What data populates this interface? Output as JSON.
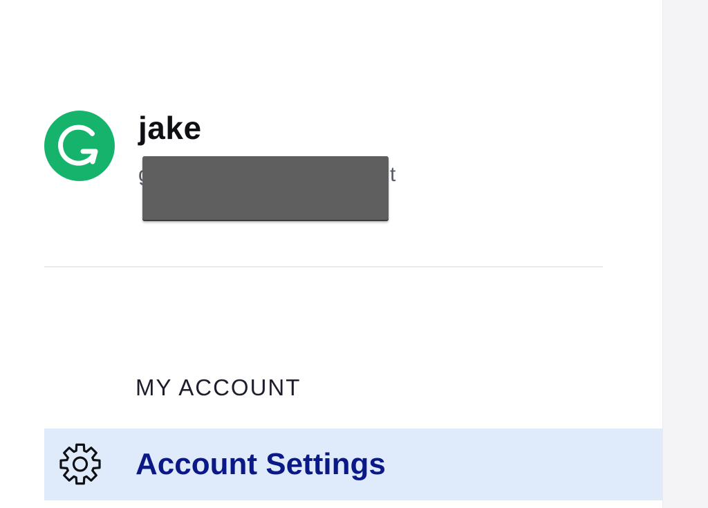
{
  "profile": {
    "name": "jake",
    "email_visible_start": "g",
    "email_visible_end": "t",
    "avatar_icon": "grammarly-g-logo",
    "avatar_color": "#15b36b"
  },
  "nav": {
    "section_label": "MY ACCOUNT",
    "items": [
      {
        "label": "Account Settings",
        "icon": "gear-icon",
        "active": true
      }
    ]
  },
  "colors": {
    "active_bg": "#dfeafb",
    "active_text": "#0b1987"
  }
}
